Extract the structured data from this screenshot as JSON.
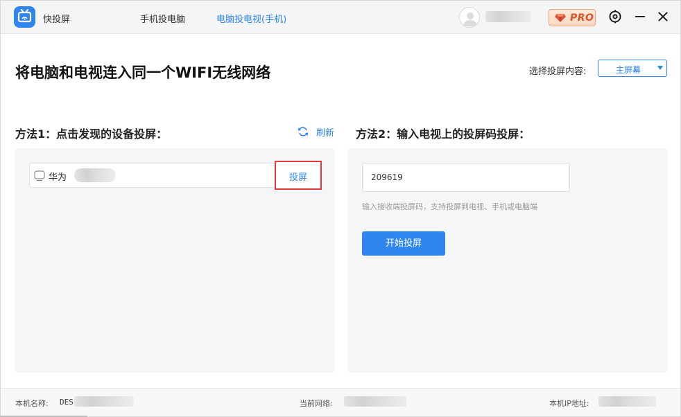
{
  "app": {
    "name": "快投屏"
  },
  "tabs": [
    {
      "label": "手机投电脑",
      "active": false
    },
    {
      "label": "电脑投电视(手机)",
      "active": true
    }
  ],
  "titlebar": {
    "pro_label": "PRO",
    "icons": [
      "settings-icon",
      "minimize-icon",
      "close-icon"
    ]
  },
  "main": {
    "headline": "将电脑和电视连入同一个WIFI无线网络",
    "select_label": "选择投屏内容:",
    "select_value": "主屏幕"
  },
  "method1": {
    "title": "方法1：点击发现的设备投屏：",
    "refresh_label": "刷新",
    "devices": [
      {
        "name": "华为",
        "cast_label": "投屏"
      }
    ]
  },
  "method2": {
    "title": "方法2：输入电视上的投屏码投屏：",
    "code_value": "209619",
    "hint": "输入接收端投屏码，支持投屏到电视、手机或电脑端",
    "start_label": "开始投屏"
  },
  "footer": {
    "pc_name_label": "本机名称:",
    "pc_name_prefix": "DES",
    "network_label": "当前网络:",
    "ip_label": "本机IP地址:"
  },
  "colors": {
    "accent": "#2e86ee",
    "highlight_border": "#e03a3a",
    "pro_text": "#d9542b"
  }
}
